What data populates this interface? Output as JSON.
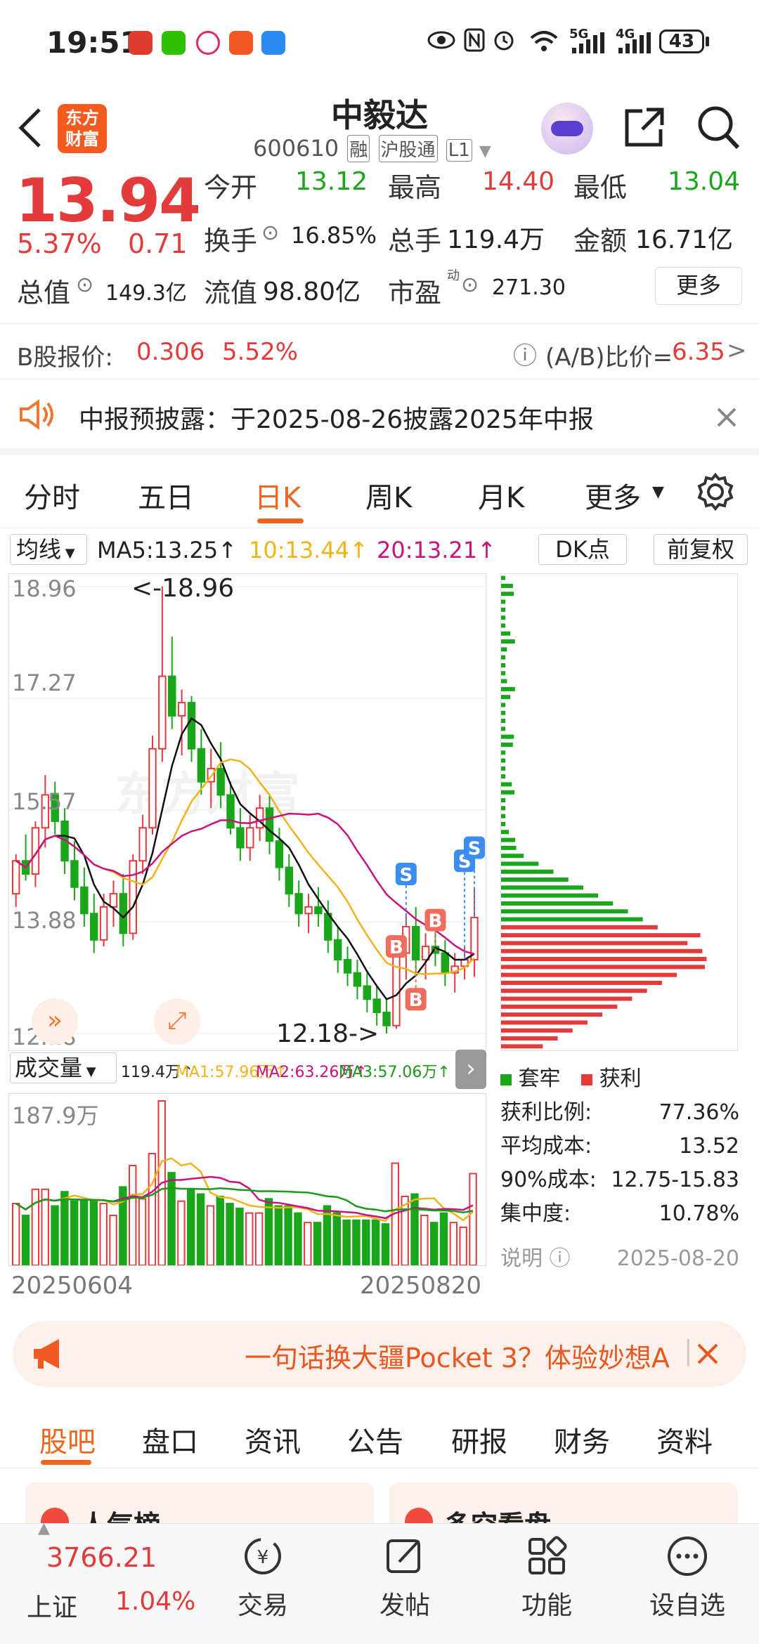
{
  "status_bar": {
    "time": "19:51",
    "network_5g": "5G",
    "network_4g": "4G",
    "battery": "43"
  },
  "header": {
    "logo_line1": "东方",
    "logo_line2": "财富",
    "title": "中毅达",
    "code": "600610",
    "tags": [
      "融",
      "沪股通",
      "L1"
    ]
  },
  "quote": {
    "price": "13.94",
    "change_pct": "5.37%",
    "change_amt": "0.71",
    "open_label": "今开",
    "open": "13.12",
    "high_label": "最高",
    "high": "14.40",
    "low_label": "最低",
    "low": "13.04",
    "turnover_label": "换手",
    "turnover": "16.85%",
    "volume_label": "总手",
    "volume": "119.4万",
    "amount_label": "金额",
    "amount": "16.71亿",
    "mktcap_label": "总值",
    "mktcap": "149.3亿",
    "float_label": "流值",
    "float_val": "98.80亿",
    "pe_label": "市盈",
    "pe_sup": "动",
    "pe": "271.30",
    "more_button": "更多"
  },
  "b_share": {
    "label": "B股报价:",
    "price": "0.306",
    "pct": "5.52%",
    "ratio_label": "(A/B)比价=",
    "ratio": "6.35",
    "arrow": ">"
  },
  "notice": {
    "text": "中报预披露：于2025-08-26披露2025年中报"
  },
  "chart_tabs": [
    "分时",
    "五日",
    "日K",
    "周K",
    "月K",
    "更多"
  ],
  "ma_bar": {
    "selector": "均线",
    "ma5": "MA5:13.25↑",
    "ma10": "10:13.44↑",
    "ma20": "20:13.21↑",
    "dk_button": "DK点",
    "fq_button": "前复权"
  },
  "chart_data": {
    "type": "candlestick",
    "price_axis": [
      "18.96",
      "17.27",
      "15.57",
      "13.88",
      "12.18"
    ],
    "ylim": [
      12.18,
      18.96
    ],
    "high_annotation": "<-18.96",
    "low_annotation": "12.18->",
    "watermark": "东方财富",
    "signals": [
      "S",
      "B",
      "S",
      "B",
      "B",
      "S"
    ],
    "candles": [
      [
        14.3,
        14.9,
        14.1,
        14.8
      ],
      [
        14.8,
        15.2,
        14.5,
        14.6
      ],
      [
        14.6,
        15.4,
        14.4,
        15.3
      ],
      [
        15.3,
        16.1,
        15.0,
        15.8
      ],
      [
        15.8,
        16.0,
        15.2,
        15.4
      ],
      [
        15.4,
        15.6,
        14.6,
        14.8
      ],
      [
        14.8,
        15.1,
        14.2,
        14.4
      ],
      [
        14.4,
        14.7,
        13.8,
        14.0
      ],
      [
        14.0,
        14.3,
        13.4,
        13.6
      ],
      [
        13.6,
        14.3,
        13.5,
        14.1
      ],
      [
        14.1,
        14.5,
        13.8,
        14.3
      ],
      [
        14.3,
        14.6,
        13.5,
        13.7
      ],
      [
        13.7,
        14.9,
        13.6,
        14.8
      ],
      [
        14.8,
        15.5,
        14.6,
        15.3
      ],
      [
        15.3,
        16.7,
        15.2,
        16.5
      ],
      [
        16.5,
        18.96,
        16.3,
        17.6
      ],
      [
        17.6,
        18.2,
        16.8,
        17.0
      ],
      [
        17.0,
        17.4,
        16.4,
        17.2
      ],
      [
        17.2,
        17.3,
        16.3,
        16.5
      ],
      [
        16.5,
        16.8,
        15.8,
        16.0
      ],
      [
        16.0,
        16.5,
        15.6,
        16.2
      ],
      [
        16.2,
        16.6,
        15.6,
        15.8
      ],
      [
        15.8,
        16.0,
        15.2,
        15.3
      ],
      [
        15.3,
        15.6,
        14.8,
        15.0
      ],
      [
        15.0,
        15.5,
        14.8,
        15.3
      ],
      [
        15.3,
        15.8,
        15.1,
        15.6
      ],
      [
        15.6,
        15.8,
        14.9,
        15.1
      ],
      [
        15.1,
        15.3,
        14.5,
        14.7
      ],
      [
        14.7,
        14.9,
        14.1,
        14.3
      ],
      [
        14.3,
        14.5,
        13.8,
        14.0
      ],
      [
        14.0,
        14.3,
        13.7,
        14.1
      ],
      [
        14.1,
        14.4,
        13.8,
        14.0
      ],
      [
        14.0,
        14.2,
        13.4,
        13.6
      ],
      [
        13.6,
        13.8,
        13.1,
        13.3
      ],
      [
        13.3,
        13.5,
        12.9,
        13.1
      ],
      [
        13.1,
        13.3,
        12.7,
        12.9
      ],
      [
        12.9,
        13.1,
        12.5,
        12.7
      ],
      [
        12.7,
        12.9,
        12.3,
        12.5
      ],
      [
        12.5,
        12.7,
        12.18,
        12.3
      ],
      [
        12.3,
        13.6,
        12.25,
        13.4
      ],
      [
        13.4,
        14.0,
        13.0,
        13.8
      ],
      [
        13.8,
        14.1,
        13.1,
        13.3
      ],
      [
        13.3,
        13.7,
        13.0,
        13.5
      ],
      [
        13.5,
        13.8,
        13.2,
        13.4
      ],
      [
        13.4,
        13.6,
        12.9,
        13.1
      ],
      [
        13.1,
        13.4,
        12.8,
        13.2
      ],
      [
        13.2,
        13.5,
        13.0,
        13.3
      ],
      [
        13.3,
        14.4,
        13.04,
        13.94
      ]
    ]
  },
  "chip_panel": {
    "legend_trapped": "套牢",
    "legend_profit": "获利",
    "rows": [
      {
        "label": "获利比例:",
        "value": "77.36%"
      },
      {
        "label": "平均成本:",
        "value": "13.52"
      },
      {
        "label": "90%成本:",
        "value": "12.75-15.83"
      },
      {
        "label": "集中度:",
        "value": "10.78%"
      }
    ],
    "note_label": "说明",
    "date": "2025-08-20",
    "colors": {
      "trapped": "#1aa61a",
      "profit": "#e33b3b"
    }
  },
  "volume": {
    "selector": "成交量",
    "vol": "119.4万↑",
    "ma1": "MA1:57.96万↑",
    "ma2": "MA2:63.26万↑",
    "ma3": "MA3:57.06万↑",
    "axis_max": "187.9万",
    "date_start": "20250604",
    "date_end": "20250820"
  },
  "promo": {
    "text": "一句话换大疆Pocket 3？体验妙想A"
  },
  "bottom_tabs": [
    "股吧",
    "盘口",
    "资讯",
    "公告",
    "研报",
    "财务",
    "资料"
  ],
  "cards": {
    "left": "人气榜",
    "right": "多空看盘"
  },
  "bottom_nav": {
    "index_value": "3766.21",
    "index_name": "上证",
    "index_pct": "1.04%",
    "items": [
      "交易",
      "发帖",
      "功能",
      "设自选"
    ]
  }
}
